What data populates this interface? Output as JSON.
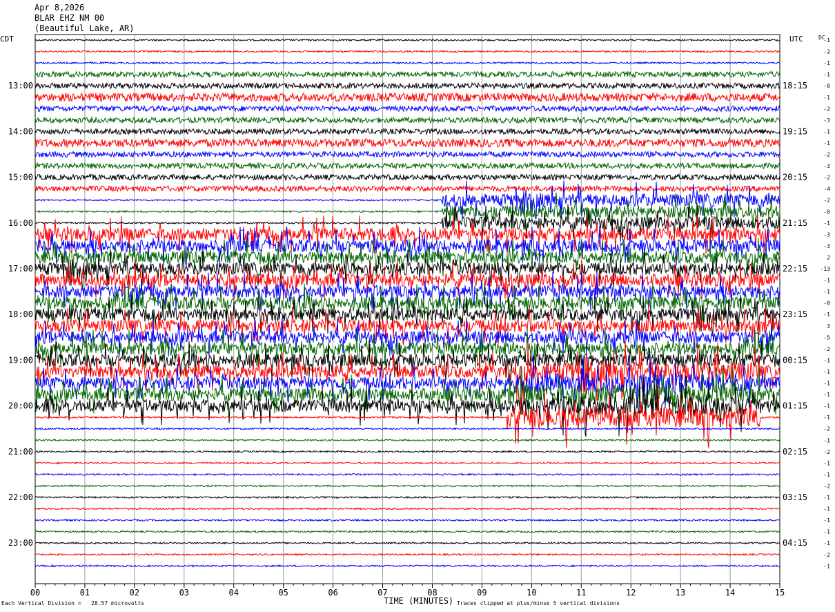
{
  "header": {
    "date": "Apr 8,2026",
    "station": "BLAR EHZ NM 00",
    "location": "(Beautiful Lake, AR)"
  },
  "axis": {
    "left_tz": "CDT",
    "right_tz": "UTC",
    "dc_label": "DC",
    "xlabel": "TIME (MINUTES)"
  },
  "footer": {
    "scale_note": "Each Vertical Division =   28.57 microvolts",
    "clip_note": "Traces clipped at plus/minus 5 vertical divisions"
  },
  "chart_data": {
    "type": "line",
    "title": "Apr 8,2026 BLAR EHZ NM 00 (Beautiful Lake, AR)",
    "xlabel": "TIME (MINUTES)",
    "xlim": [
      0,
      15
    ],
    "x_ticks": [
      "00",
      "01",
      "02",
      "03",
      "04",
      "05",
      "06",
      "07",
      "08",
      "09",
      "10",
      "11",
      "12",
      "13",
      "14",
      "15"
    ],
    "trace_colors": [
      "#000000",
      "#ff0000",
      "#0000ff",
      "#006400"
    ],
    "trace_count": 47,
    "trace_interval_minutes": 15,
    "left_hour_labels": [
      "13:00",
      "14:00",
      "15:00",
      "16:00",
      "17:00",
      "18:00",
      "19:00",
      "20:00",
      "21:00",
      "22:00",
      "23:00"
    ],
    "right_hour_labels": [
      "18:15",
      "19:15",
      "20:15",
      "21:15",
      "22:15",
      "23:15",
      "00:15",
      "01:15",
      "02:15",
      "03:15",
      "04:15"
    ],
    "dc_offsets": [
      "-1",
      "-2",
      "-1",
      "-1",
      "-0",
      "-1",
      "-2",
      "-3",
      "-1",
      "-1",
      "-2",
      "-3",
      "-2",
      "-4",
      "-2",
      "-0",
      "-1",
      "-3",
      "-3",
      "2",
      "-13",
      "-1",
      "-1",
      "-0",
      "-1",
      "3",
      "-5",
      "-2",
      "-1",
      "-1",
      "-1",
      "-1",
      "-1",
      "-1",
      "-2",
      "-1",
      "-2",
      "-1",
      "-1",
      "-2",
      "-1",
      "-1",
      "-1",
      "-1",
      "-1",
      "-2",
      "-1"
    ],
    "activity_windows": [
      {
        "trace_start": 3,
        "trace_end": 13,
        "x_start": 0,
        "x_end": 15,
        "level": "moderate"
      },
      {
        "trace_start": 17,
        "trace_end": 32,
        "x_start": 0,
        "x_end": 8.2,
        "level": "strong"
      },
      {
        "trace_start": 14,
        "trace_end": 32,
        "x_start": 8.2,
        "x_end": 15,
        "level": "strong"
      },
      {
        "trace_start": 29,
        "trace_end": 33,
        "x_start": 9.5,
        "x_end": 14.6,
        "level": "red-burst"
      }
    ],
    "notes": [
      "Each Vertical Division =   28.57 microvolts",
      "Traces clipped at plus/minus 5 vertical divisions"
    ]
  }
}
